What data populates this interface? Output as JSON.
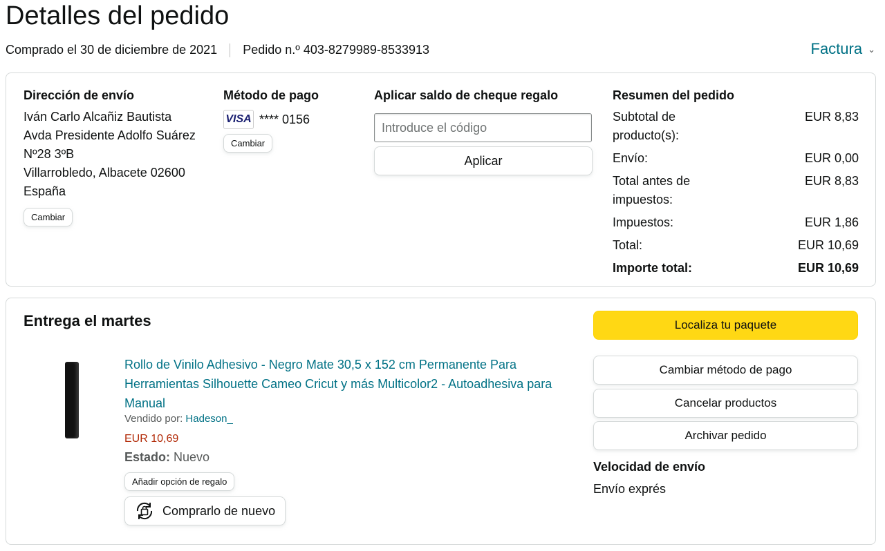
{
  "page": {
    "title": "Detalles del pedido",
    "purchased": "Comprado el 30 de diciembre de 2021",
    "order_number": "Pedido n.º 403-8279989-8533913",
    "invoice": "Factura"
  },
  "shipping": {
    "heading": "Dirección de envío",
    "lines": [
      "Iván Carlo Alcañiz Bautista",
      "Avda Presidente Adolfo Suárez",
      "Nº28 3ºB",
      "Villarrobledo, Albacete 02600",
      "España"
    ],
    "change": "Cambiar"
  },
  "payment": {
    "heading": "Método de pago",
    "card_brand": "VISA",
    "card_number": "**** 0156",
    "change": "Cambiar"
  },
  "gift_card": {
    "heading": "Aplicar saldo de cheque regalo",
    "placeholder": "Introduce el código",
    "apply": "Aplicar"
  },
  "summary": {
    "heading": "Resumen del pedido",
    "rows": [
      {
        "label": "Subtotal de producto(s):",
        "value": "EUR 8,83"
      },
      {
        "label": "Envío:",
        "value": "EUR 0,00"
      },
      {
        "label": "Total antes de impuestos:",
        "value": "EUR 8,83"
      },
      {
        "label": "Impuestos:",
        "value": "EUR 1,86"
      },
      {
        "label": "Total:",
        "value": "EUR 10,69"
      }
    ],
    "grand_total": {
      "label": "Importe total:",
      "value": "EUR 10,69"
    }
  },
  "delivery": {
    "heading": "Entrega el martes",
    "product_title": "Rollo de Vinilo Adhesivo - Negro Mate 30,5 x 152 cm Permanente Para Herramientas Silhouette Cameo Cricut y más Multicolor2 - Autoadhesiva para Manual",
    "sold_by_label": "Vendido por:",
    "seller": "Hadeson_",
    "price": "EUR 10,69",
    "state_label": "Estado:",
    "state_value": "Nuevo",
    "gift_option": "Añadir opción de regalo",
    "buy_again": "Comprarlo de nuevo"
  },
  "actions": {
    "track": "Localiza tu paquete",
    "change_payment": "Cambiar método de pago",
    "cancel": "Cancelar productos",
    "archive": "Archivar pedido"
  },
  "shipping_speed": {
    "heading": "Velocidad de envío",
    "value": "Envío exprés"
  },
  "colors": {
    "link": "#007185",
    "primary_button": "#ffd814",
    "price": "#b12704"
  },
  "icons": [
    "chevron-down-icon",
    "visa-card-icon",
    "buy-again-icon"
  ]
}
